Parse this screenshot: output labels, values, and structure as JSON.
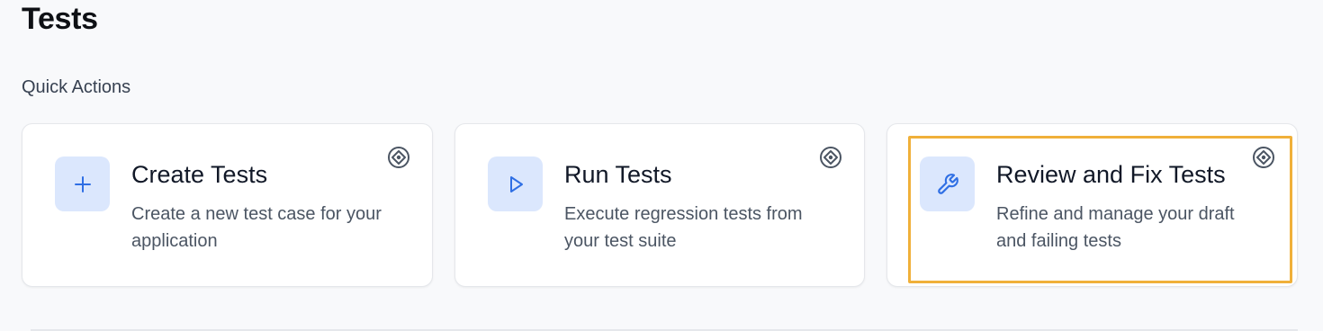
{
  "page": {
    "title": "Tests"
  },
  "quick_actions": {
    "label": "Quick Actions",
    "cards": [
      {
        "title": "Create Tests",
        "description": "Create a new test case for your application",
        "icon": "plus-icon"
      },
      {
        "title": "Run Tests",
        "description": "Execute regression tests from your test suite",
        "icon": "play-icon"
      },
      {
        "title": "Review and Fix Tests",
        "description": "Refine and manage your draft and failing tests",
        "icon": "wrench-icon"
      }
    ],
    "corner_icon": "target-icon"
  },
  "colors": {
    "accent": "#2f6fe4",
    "icon_bg": "#dbe7fd",
    "highlight": "#f0b03a",
    "page_bg": "#f8f9fb"
  }
}
